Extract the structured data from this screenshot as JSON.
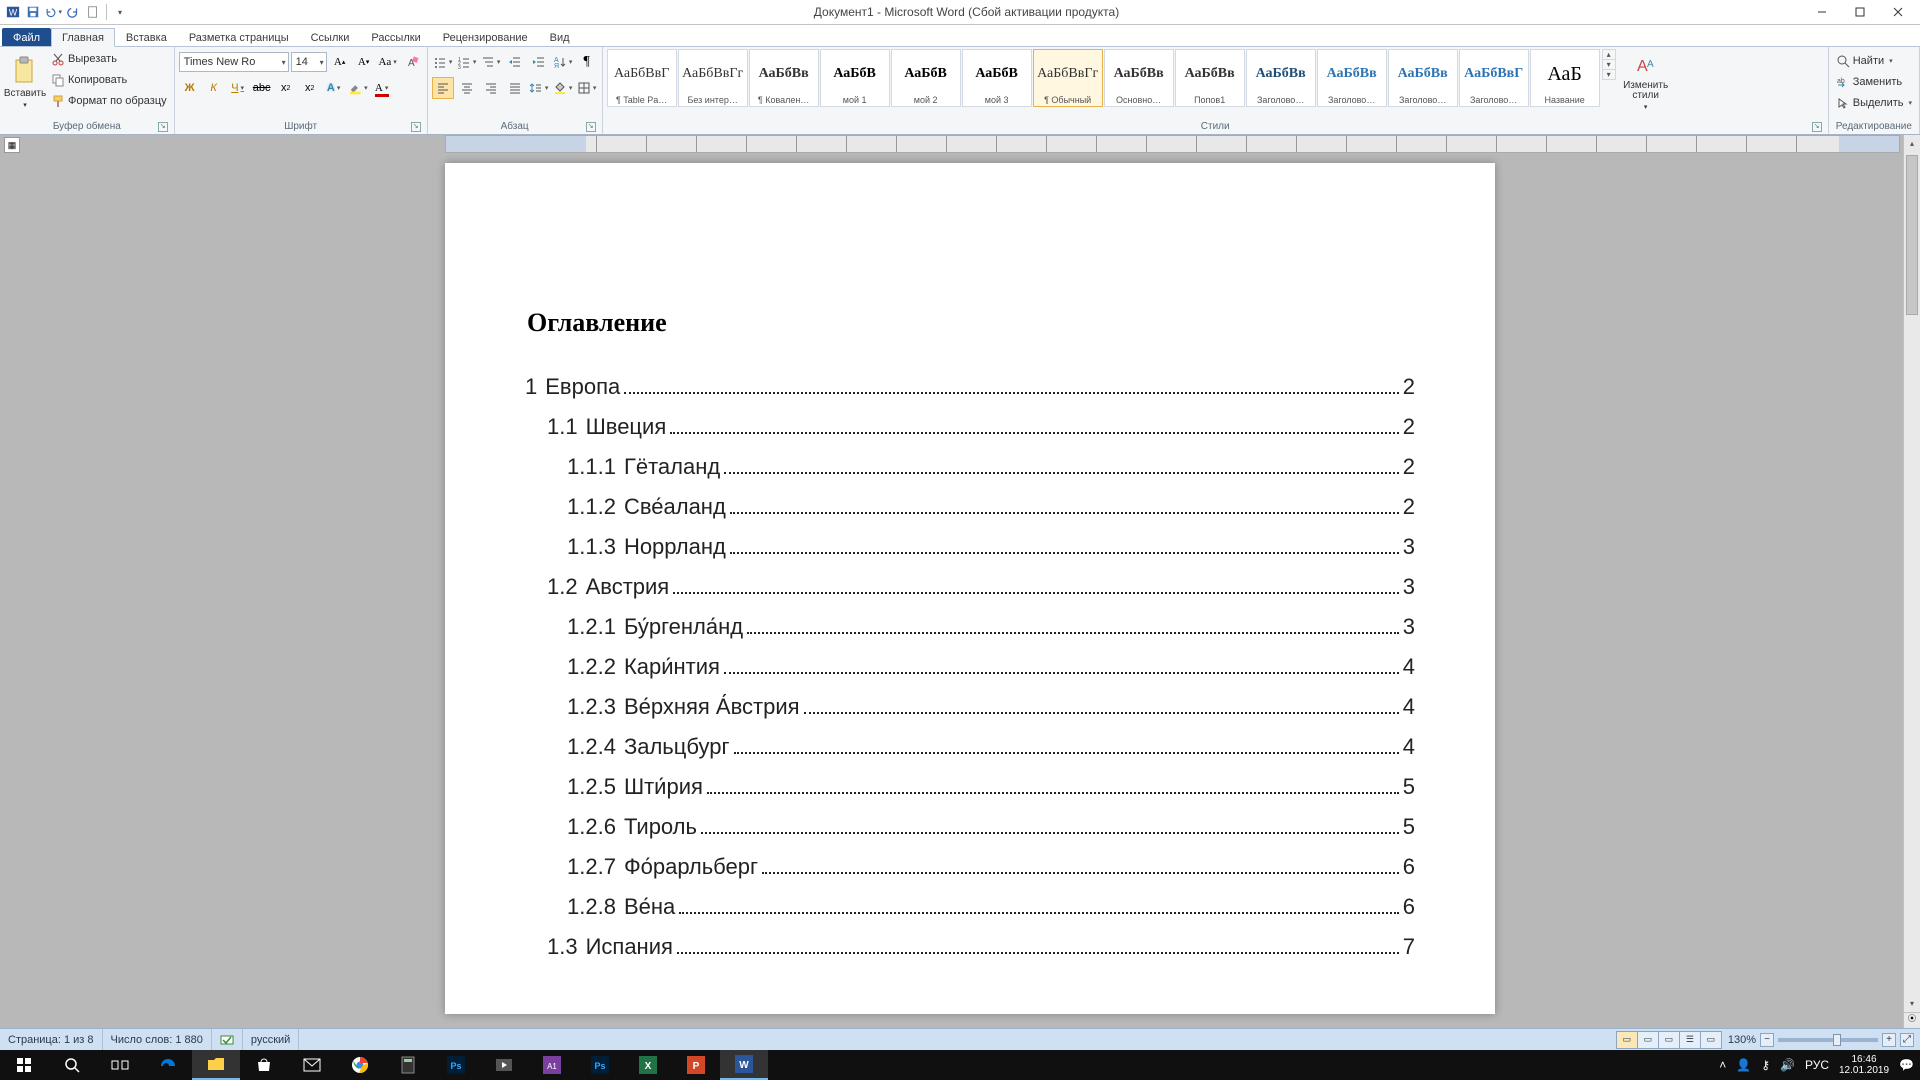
{
  "title": "Документ1 - Microsoft Word (Сбой активации продукта)",
  "tabs": {
    "file": "Файл",
    "home": "Главная",
    "insert": "Вставка",
    "layout": "Разметка страницы",
    "refs": "Ссылки",
    "mail": "Рассылки",
    "review": "Рецензирование",
    "view": "Вид"
  },
  "clipboard": {
    "paste": "Вставить",
    "cut": "Вырезать",
    "copy": "Копировать",
    "fmt": "Формат по образцу",
    "label": "Буфер обмена"
  },
  "font": {
    "name": "Times New Ro",
    "size": "14",
    "label": "Шрифт"
  },
  "para": {
    "label": "Абзац"
  },
  "styles": {
    "label": "Стили",
    "change": "Изменить стили",
    "items": [
      {
        "prev": "АаБбВвГ",
        "name": "¶ Table Pa…"
      },
      {
        "prev": "АаБбВвГг",
        "name": "Без интер…"
      },
      {
        "prev": "АаБбВв",
        "name": "¶ Ковален…"
      },
      {
        "prev": "АаБбВ",
        "name": "мой 1"
      },
      {
        "prev": "АаБбВ",
        "name": "мой 2"
      },
      {
        "prev": "АаБбВ",
        "name": "мой 3"
      },
      {
        "prev": "АаБбВвГг",
        "name": "¶ Обычный"
      },
      {
        "prev": "АаБбВв",
        "name": "Основно…"
      },
      {
        "prev": "АаБбВв",
        "name": "Попов1"
      },
      {
        "prev": "АаБбВв",
        "name": "Заголово…"
      },
      {
        "prev": "АаБбВв",
        "name": "Заголово…"
      },
      {
        "prev": "АаБбВв",
        "name": "Заголово…"
      },
      {
        "prev": "АаБбВвГ",
        "name": "Заголово…"
      },
      {
        "prev": "АаБ",
        "name": "Название"
      }
    ],
    "selected": 6
  },
  "editing": {
    "find": "Найти",
    "replace": "Заменить",
    "select": "Выделить",
    "label": "Редактирование"
  },
  "doc": {
    "heading": "Оглавление",
    "toc": [
      {
        "lvl": 1,
        "num": "1",
        "txt": "Европа",
        "pg": "2"
      },
      {
        "lvl": 2,
        "num": "1.1",
        "txt": "Швеция",
        "pg": "2"
      },
      {
        "lvl": 3,
        "num": "1.1.1",
        "txt": "Гёталанд",
        "pg": "2"
      },
      {
        "lvl": 3,
        "num": "1.1.2",
        "txt": "Све́аланд",
        "pg": "2"
      },
      {
        "lvl": 3,
        "num": "1.1.3",
        "txt": "Норрланд",
        "pg": "3"
      },
      {
        "lvl": 2,
        "num": "1.2",
        "txt": "Австрия",
        "pg": "3"
      },
      {
        "lvl": 3,
        "num": "1.2.1",
        "txt": "Бу́ргенла́нд",
        "pg": "3"
      },
      {
        "lvl": 3,
        "num": "1.2.2",
        "txt": "Кари́нтия",
        "pg": "4"
      },
      {
        "lvl": 3,
        "num": "1.2.3",
        "txt": "Ве́рхняя А́встрия",
        "pg": "4"
      },
      {
        "lvl": 3,
        "num": "1.2.4",
        "txt": "Зальцбург",
        "pg": "4"
      },
      {
        "lvl": 3,
        "num": "1.2.5",
        "txt": "Шти́рия",
        "pg": "5"
      },
      {
        "lvl": 3,
        "num": "1.2.6",
        "txt": "Тироль",
        "pg": "5"
      },
      {
        "lvl": 3,
        "num": "1.2.7",
        "txt": "Фо́рарльберг",
        "pg": "6"
      },
      {
        "lvl": 3,
        "num": "1.2.8",
        "txt": "Ве́на",
        "pg": "6"
      },
      {
        "lvl": 2,
        "num": "1.3",
        "txt": "Испания",
        "pg": "7"
      }
    ]
  },
  "status": {
    "page": "Страница: 1 из 8",
    "words": "Число слов: 1 880",
    "lang": "русский",
    "zoom": "130%"
  },
  "tray": {
    "lang": "РУС",
    "time": "16:46",
    "date": "12.01.2019"
  }
}
